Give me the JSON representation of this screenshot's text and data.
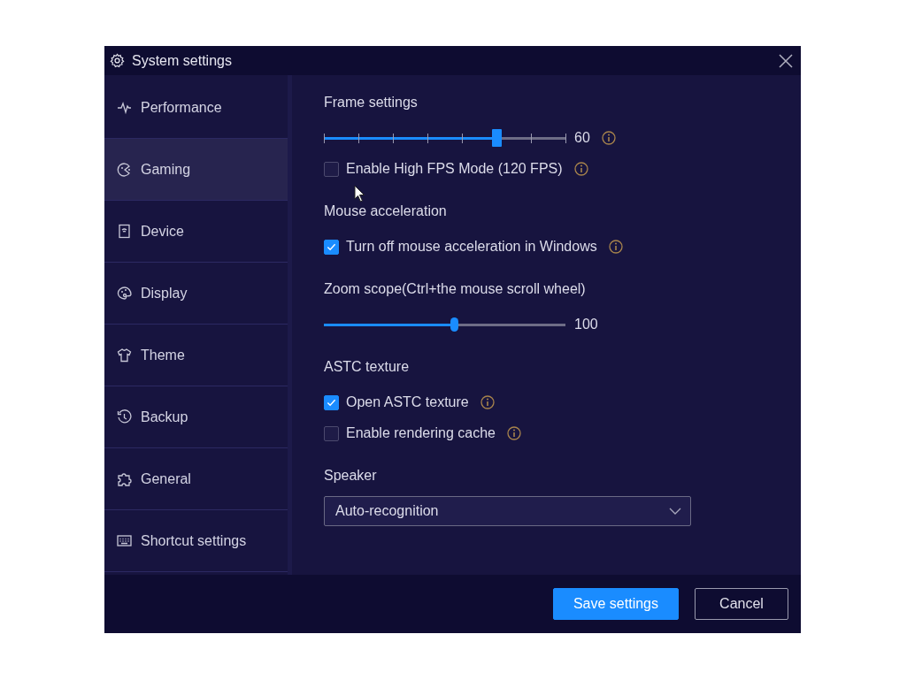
{
  "window": {
    "title": "System settings"
  },
  "sidebar": {
    "items": [
      {
        "label": "Performance",
        "selected": false
      },
      {
        "label": "Gaming",
        "selected": true
      },
      {
        "label": "Device",
        "selected": false
      },
      {
        "label": "Display",
        "selected": false
      },
      {
        "label": "Theme",
        "selected": false
      },
      {
        "label": "Backup",
        "selected": false
      },
      {
        "label": "General",
        "selected": false
      },
      {
        "label": "Shortcut settings",
        "selected": false
      }
    ]
  },
  "sections": [
    {
      "title": "Frame settings",
      "controls": [
        {
          "kind": "slider",
          "ticks": true,
          "level": 0.714,
          "reading": "60",
          "info": true
        },
        {
          "kind": "checkbox",
          "label": "Enable High FPS Mode (120 FPS)",
          "checked": false,
          "info": true
        }
      ]
    },
    {
      "title": "Mouse acceleration",
      "controls": [
        {
          "kind": "checkbox",
          "label": "Turn off mouse acceleration in Windows",
          "checked": true,
          "info": true
        }
      ]
    },
    {
      "title": "Zoom scope(Ctrl+the mouse scroll wheel)",
      "controls": [
        {
          "kind": "slider",
          "ticks": false,
          "level": 0.537,
          "reading": "100",
          "info": false
        }
      ]
    },
    {
      "title": "ASTC texture",
      "controls": [
        {
          "kind": "checkbox",
          "label": "Open ASTC texture",
          "checked": true,
          "info": true
        },
        {
          "kind": "checkbox",
          "label": "Enable rendering cache",
          "checked": false,
          "info": true
        }
      ]
    },
    {
      "title": "Speaker",
      "controls": [
        {
          "kind": "dropdown",
          "value": "Auto-recognition"
        }
      ]
    }
  ],
  "buttons": [
    {
      "label": "Save settings",
      "primary": true
    },
    {
      "label": "Cancel",
      "primary": false
    }
  ]
}
